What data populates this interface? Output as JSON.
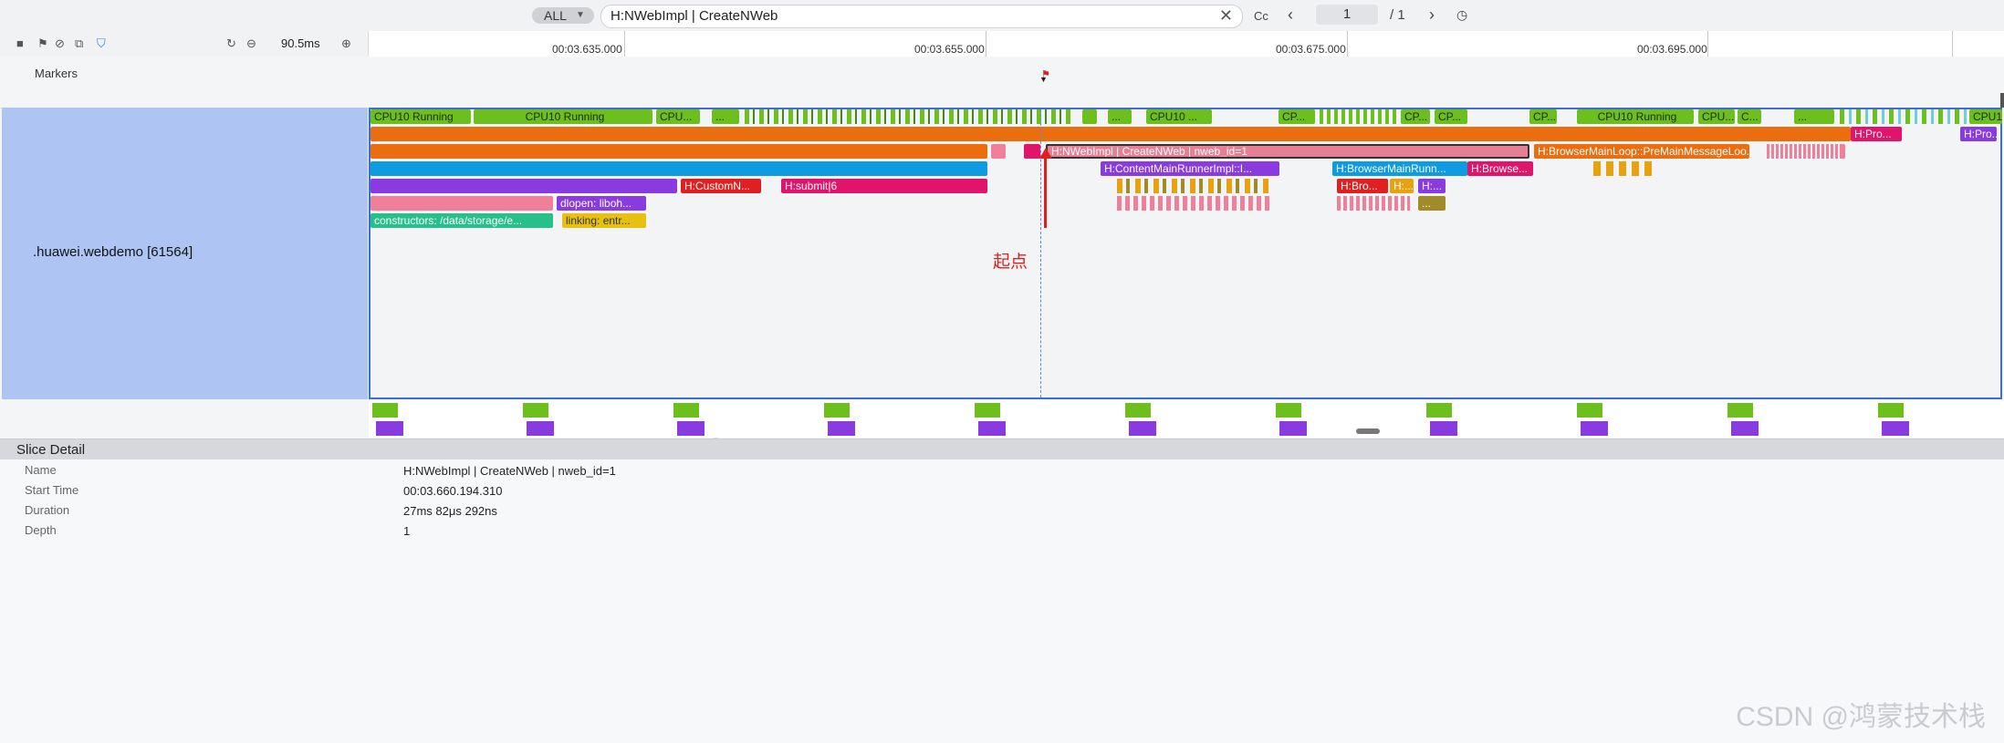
{
  "toolbar": {
    "filter_label": "ALL",
    "search_value": "H:NWebImpl | CreateNWeb",
    "case_label": "Cc",
    "page_current": "1",
    "page_total": "/ 1"
  },
  "tools": {
    "zoom_value": "90.5ms"
  },
  "ruler": {
    "ticks": [
      "00:03.635.000",
      "00:03.655.000",
      "00:03.675.000",
      "00:03.695.000"
    ]
  },
  "tracks": {
    "markers_label": "Markers",
    "process_label": ".huawei.webdemo [61564]"
  },
  "slices": {
    "cpu1": "CPU10 Running",
    "cpu2": "CPU10 Running",
    "cpu3": "CPU...",
    "cpu4": "CPU10 ...",
    "cpu5": "CP...",
    "cpu6": "CP...",
    "cpu7": "CP...",
    "cpu8": "CP...",
    "cpu9": "CPU10 Running",
    "cpu10": "CPU...",
    "cpu11": "C...",
    "cpu12": "CPU1",
    "cpu_dots": "...",
    "h_pro": "H:Pro...",
    "createnweb": "H:NWebImpl | CreateNWeb | nweb_id=1",
    "premain": "H:BrowserMainLoop::PreMainMessageLoo...",
    "content_main": "H:ContentMainRunnerImpl::I...",
    "browser_main": "H:BrowserMainRunn...",
    "browse": "H:Browse...",
    "custom": "H:CustomN...",
    "submit": "H:submit|6",
    "dlopen": "dlopen:  liboh...",
    "constructors": "constructors:  /data/storage/e...",
    "linking": "linking: entr...",
    "bro": "H:Bro...",
    "h_dots": "H:...",
    "dots": "..."
  },
  "annotation": {
    "start_label": "起点"
  },
  "detail": {
    "title": "Slice Detail",
    "rows": [
      {
        "label": "Name",
        "value": "H:NWebImpl | CreateNWeb | nweb_id=1"
      },
      {
        "label": "Start Time",
        "value": "00:03.660.194.310"
      },
      {
        "label": "Duration",
        "value": "27ms 82μs 292ns"
      },
      {
        "label": "Depth",
        "value": "1"
      }
    ]
  },
  "watermark": "CSDN @鸿蒙技术栈"
}
